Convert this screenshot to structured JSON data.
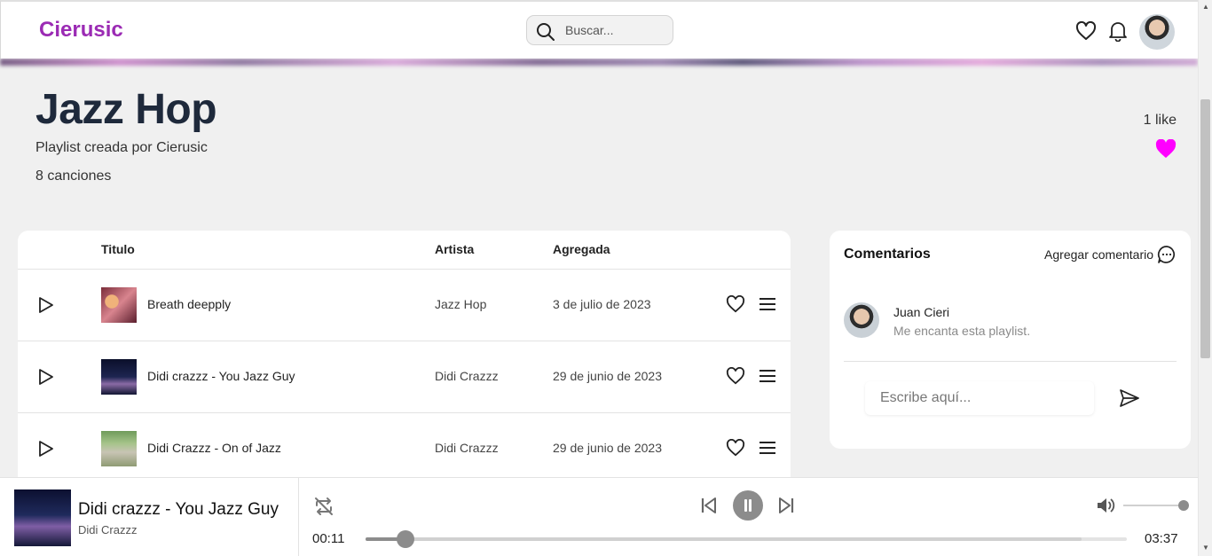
{
  "nav": {
    "brand": "Cierusic",
    "search_placeholder": "Buscar..."
  },
  "playlist": {
    "title": "Jazz Hop",
    "subtitle": "Playlist creada por Cierusic",
    "song_count": "8 canciones",
    "likes": "1 like",
    "liked_color": "#ff00ff"
  },
  "table": {
    "columns": [
      "Titulo",
      "Artista",
      "Agregada"
    ],
    "rows": [
      {
        "title": "Breath deepply",
        "artist": "Jazz Hop",
        "date": "3 de julio de 2023"
      },
      {
        "title": "Didi crazzz - You Jazz Guy",
        "artist": "Didi Crazzz",
        "date": "29 de junio de 2023"
      },
      {
        "title": "Didi Crazzz - On of Jazz",
        "artist": "Didi Crazzz",
        "date": "29 de junio de 2023"
      }
    ]
  },
  "comments": {
    "heading": "Comentarios",
    "add_label": "Agregar comentario",
    "items": [
      {
        "author": "Juan Cieri",
        "text": "Me encanta esta playlist."
      }
    ],
    "input_placeholder": "Escribe aquí..."
  },
  "player": {
    "song": "Didi crazzz - You Jazz Guy",
    "artist": "Didi Crazzz",
    "current_time": "00:11",
    "total_time": "03:37",
    "progress": 0.052,
    "buffered": 0.94,
    "volume": 1.0,
    "state": "playing"
  },
  "colors": {
    "brand": "#9b2bb4",
    "like": "#ff00ff"
  }
}
